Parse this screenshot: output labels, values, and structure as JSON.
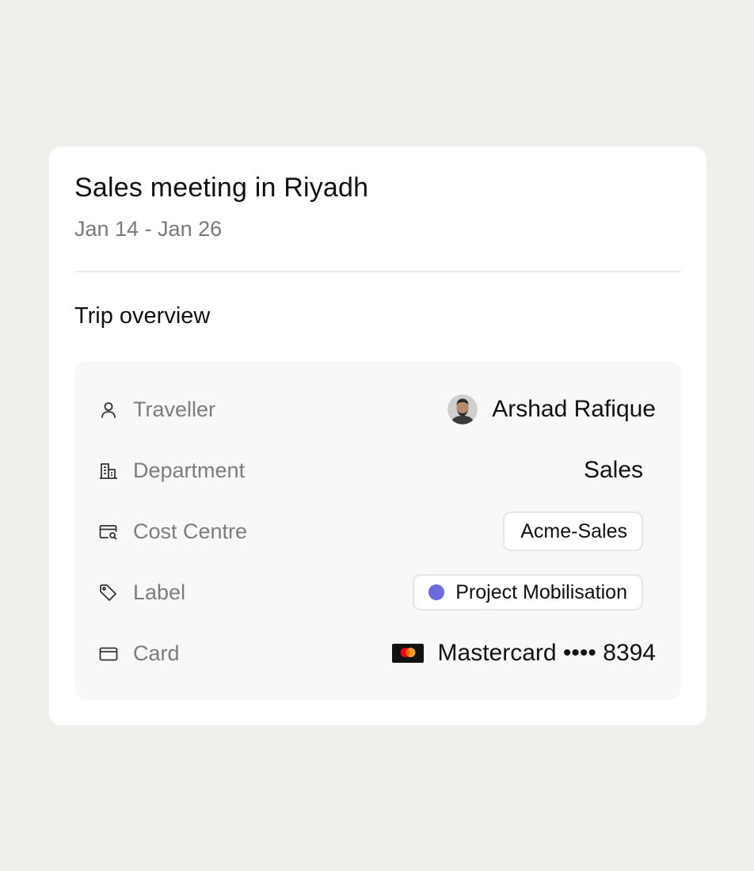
{
  "trip": {
    "title": "Sales meeting in Riyadh",
    "dates": "Jan 14 - Jan 26"
  },
  "overview": {
    "section_title": "Trip overview",
    "rows": [
      {
        "icon": "person-icon",
        "label": "Traveller",
        "value": "Arshad Rafique"
      },
      {
        "icon": "building-icon",
        "label": "Department",
        "value": "Sales"
      },
      {
        "icon": "cost-centre-icon",
        "label": "Cost Centre",
        "value": "Acme-Sales"
      },
      {
        "icon": "tag-icon",
        "label": "Label",
        "value": "Project Mobilisation",
        "dot_color": "#6b6bdc"
      },
      {
        "icon": "credit-card-icon",
        "label": "Card",
        "value": "Mastercard •••• 8394",
        "card_brand": "mastercard-logo"
      }
    ]
  },
  "colors": {
    "page_background": "#f0efec",
    "card_background": "#ffffff",
    "panel_background": "#f8f8f8",
    "label_dot": "#6b6bdc",
    "muted_text": "#7d7d7d"
  }
}
